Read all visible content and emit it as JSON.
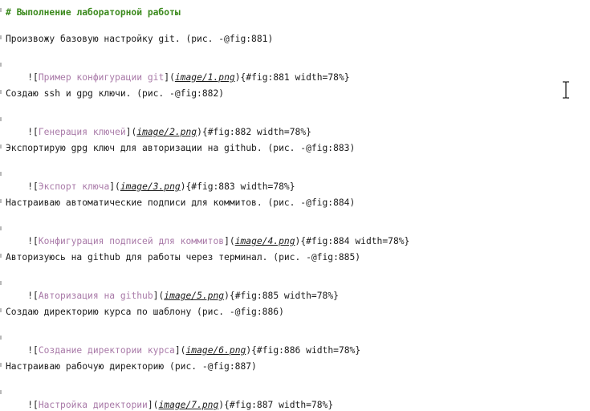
{
  "heading": "# Выполнение лабораторной работы",
  "paragraphs": [
    "Произвожу базовую настройку git. (рис. -@fig:881)",
    "Создаю ssh и gpg ключи. (рис. -@fig:882)",
    "Экспортирую gpg ключ для авторизации на github. (рис. -@fig:883)",
    "Настраиваю автоматические подписи для коммитов. (рис. -@fig:884)",
    "Авторизуюсь на github для работы через терминал. (рис. -@fig:885)",
    "Создаю директорию курса по шаблону (рис. -@fig:886)",
    "Настраиваю рабочую директорию (рис. -@fig:887)"
  ],
  "images": [
    {
      "alt": "Пример конфигурации git",
      "path": "image/1.png",
      "attrs": "{#fig:881 width=78%}"
    },
    {
      "alt": "Генерация ключей",
      "path": "image/2.png",
      "attrs": "{#fig:882 width=78%}"
    },
    {
      "alt": "Экспорт ключа",
      "path": "image/3.png",
      "attrs": "{#fig:883 width=78%}"
    },
    {
      "alt": "Конфигурация подписей для коммитов",
      "path": "image/4.png",
      "attrs": "{#fig:884 width=78%}"
    },
    {
      "alt": "Авторизация на github",
      "path": "image/5.png",
      "attrs": "{#fig:885 width=78%}"
    },
    {
      "alt": "Создание директории курса",
      "path": "image/6.png",
      "attrs": "{#fig:886 width=78%}"
    },
    {
      "alt": "Настройка директории",
      "path": "image/7.png",
      "attrs": "{#fig:887 width=78%}"
    }
  ],
  "syntax": {
    "img_open": "![",
    "alt_close": "](",
    "path_close": ")"
  },
  "colors": {
    "heading": "#3c8a1e",
    "alt_text": "#a97aa8",
    "text": "#1a1a1a"
  },
  "icons": {
    "cursor": "text-cursor-ibeam-icon"
  }
}
